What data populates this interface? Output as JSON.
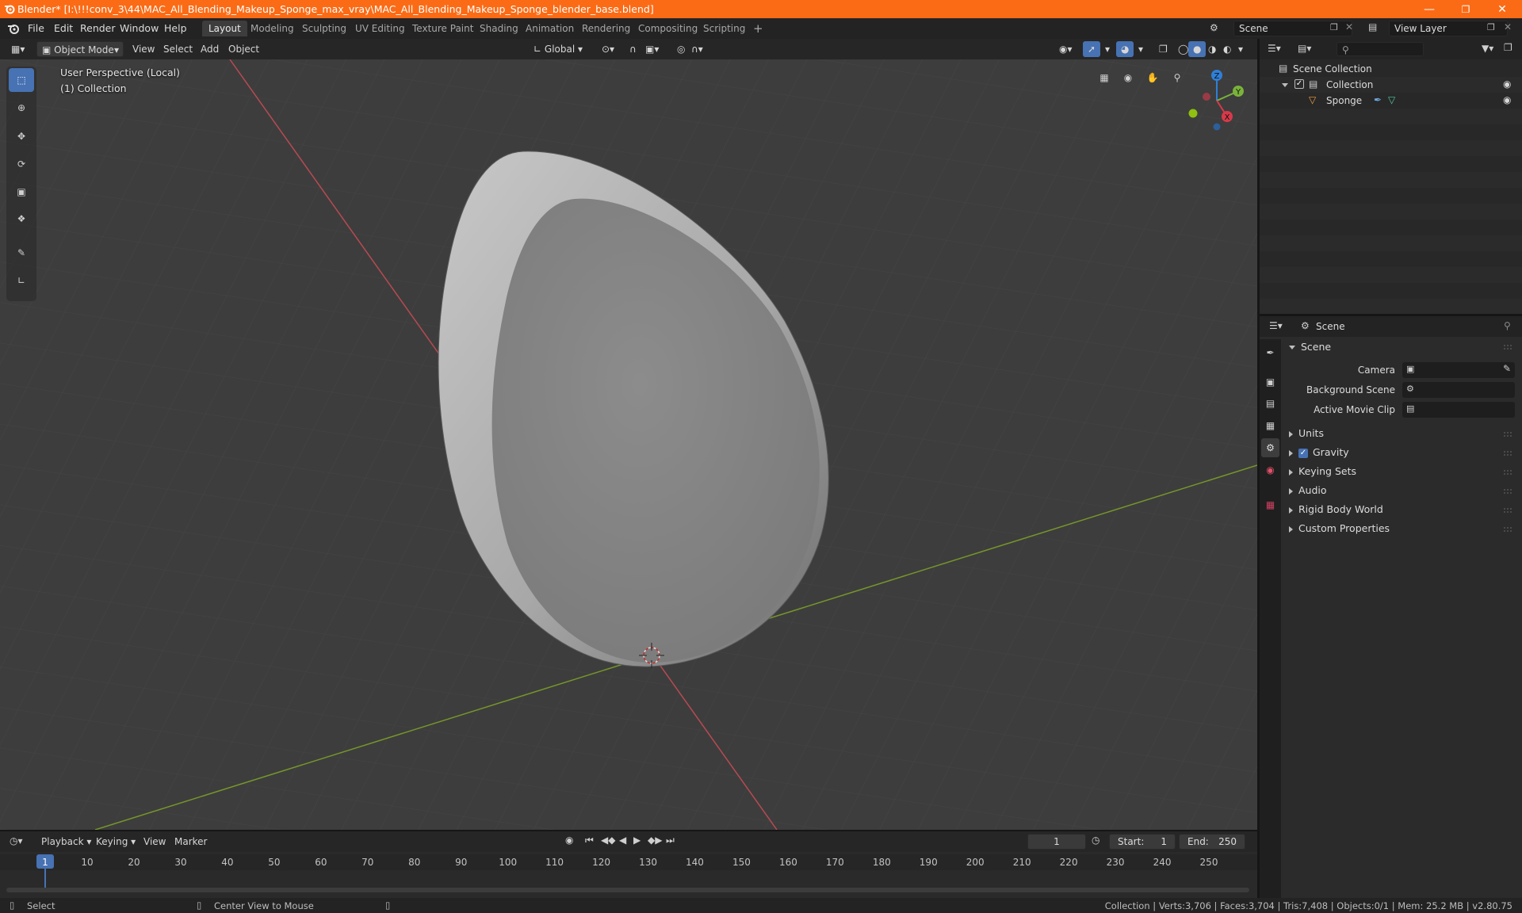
{
  "window": {
    "title": "Blender* [I:\\!!!conv_3\\44\\MAC_All_Blending_Makeup_Sponge_max_vray\\MAC_All_Blending_Makeup_Sponge_blender_base.blend]",
    "accent_color": "#fb6b16"
  },
  "menu": {
    "items": [
      "File",
      "Edit",
      "Render",
      "Window",
      "Help"
    ]
  },
  "workspaces": {
    "active": "Layout",
    "tabs": [
      "Layout",
      "Modeling",
      "Sculpting",
      "UV Editing",
      "Texture Paint",
      "Shading",
      "Animation",
      "Rendering",
      "Compositing",
      "Scripting"
    ],
    "add_label": "+"
  },
  "scene_selector": {
    "value": "Scene"
  },
  "view_layer_selector": {
    "value": "View Layer"
  },
  "viewport_header": {
    "mode": "Object Mode",
    "menus": [
      "View",
      "Select",
      "Add",
      "Object"
    ],
    "transform_orientation": "Global"
  },
  "viewport": {
    "perspective_label": "User Perspective (Local)",
    "collection_label": "(1) Collection",
    "gizmo_axes": {
      "z": "Z",
      "y": "Y",
      "x": "X"
    },
    "selected_color": "#4772b3"
  },
  "outliner": {
    "root": "Scene Collection",
    "collection": "Collection",
    "object": "Sponge",
    "search_placeholder": ""
  },
  "properties": {
    "context": "Scene",
    "panel_title": "Scene",
    "fields": {
      "camera": "Camera",
      "background_scene": "Background Scene",
      "active_movie_clip": "Active Movie Clip"
    },
    "sections": [
      "Units",
      "Gravity",
      "Keying Sets",
      "Audio",
      "Rigid Body World",
      "Custom Properties"
    ],
    "gravity_checked": true
  },
  "timeline": {
    "menus": [
      "Playback",
      "Keying",
      "View",
      "Marker"
    ],
    "current_frame": "1",
    "start_label": "Start:",
    "start_value": "1",
    "end_label": "End:",
    "end_value": "250",
    "ticks": [
      "1",
      "10",
      "20",
      "30",
      "40",
      "50",
      "60",
      "70",
      "80",
      "90",
      "100",
      "110",
      "120",
      "130",
      "140",
      "150",
      "160",
      "170",
      "180",
      "190",
      "200",
      "210",
      "220",
      "230",
      "240",
      "250"
    ]
  },
  "status_bar": {
    "left_action": "Select",
    "middle_action": "Center View to Mouse",
    "stats": "Collection | Verts:3,706 | Faces:3,704 | Tris:7,408 | Objects:0/1 | Mem: 25.2 MB | v2.80.75"
  }
}
